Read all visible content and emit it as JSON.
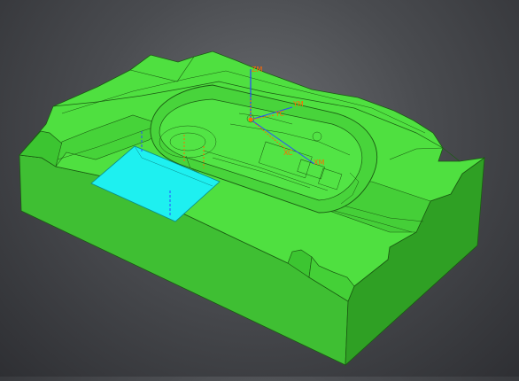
{
  "viewport": {
    "background_color": "#4d4e52",
    "part_color": "#4fe040",
    "selected_face_color": "#1ef0f0",
    "edge_color": "#1a5c12"
  },
  "csys": {
    "zm_label": "ZM",
    "ym_label": "YM",
    "xm_label": "XM",
    "yc_label": "YC",
    "xc_label": "XC",
    "zm_color": "#2b4cff",
    "label_color": "#ff6a00"
  }
}
